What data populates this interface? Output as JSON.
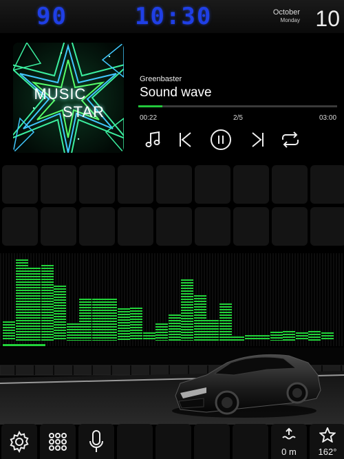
{
  "status": {
    "speed": "90",
    "clock": "10:30",
    "month": "October",
    "weekday": "Monday",
    "day": "10",
    "digit_color": "#1f3fe6"
  },
  "player": {
    "album_art_text": [
      "MUSIC",
      "STAR"
    ],
    "artist": "Greenbaster",
    "track": "Sound wave",
    "elapsed": "00:22",
    "position": "2/5",
    "total": "03:00",
    "progress": 0.12,
    "accent": "#23c83c",
    "controls": [
      "playlist-icon",
      "previous-icon",
      "pause-icon",
      "next-icon",
      "repeat-icon"
    ]
  },
  "equalizer": {
    "color": "#22d43a",
    "levels": [
      0.24,
      1.0,
      0.9,
      0.93,
      0.68,
      0.21,
      0.52,
      0.52,
      0.52,
      0.4,
      0.41,
      0.1,
      0.21,
      0.32,
      0.75,
      0.56,
      0.25,
      0.46,
      0.05,
      0.07,
      0.07,
      0.11,
      0.12,
      0.1,
      0.12,
      0.1
    ]
  },
  "bottom_bar": {
    "distance": "0 m",
    "heading": "162°",
    "icons": [
      "gear-icon",
      "apps-grid-icon",
      "microphone-icon",
      "elevation-icon",
      "star-icon"
    ]
  }
}
